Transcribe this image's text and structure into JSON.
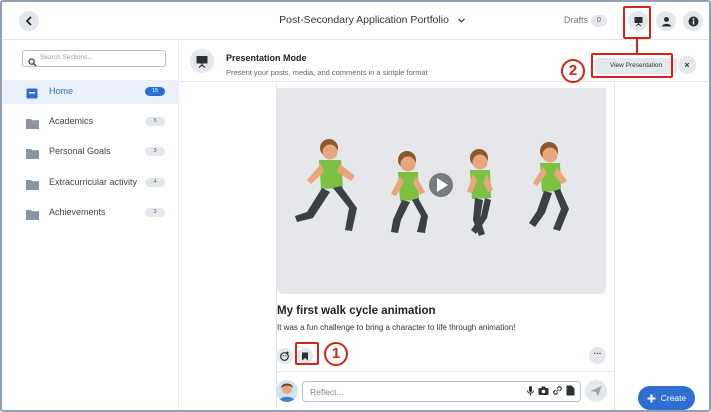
{
  "header": {
    "title": "Post-Secondary Application Portfolio",
    "drafts_label": "Drafts",
    "drafts_count": "0"
  },
  "sidebar": {
    "search_placeholder": "Search Sections...",
    "items": [
      {
        "label": "Home",
        "count": "15",
        "active": true
      },
      {
        "label": "Academics",
        "count": "5"
      },
      {
        "label": "Personal Goals",
        "count": "3"
      },
      {
        "label": "Extracurricular activity",
        "count": "4"
      },
      {
        "label": "Achievements",
        "count": "3"
      }
    ]
  },
  "banner": {
    "title": "Presentation Mode",
    "subtitle": "Present your posts, media, and comments in a simple format",
    "view_button": "View Presentation",
    "close_symbol": "×"
  },
  "post": {
    "title": "My first walk cycle animation",
    "text": "It was a fun challenge to bring a character to life through animation!",
    "more_symbol": "···"
  },
  "comment": {
    "placeholder": "Reflect..."
  },
  "create_button": "Create",
  "annotations": {
    "step1": "1",
    "step2": "2"
  },
  "colors": {
    "accent": "#2e6fd1",
    "highlight": "#d6221b",
    "shirt": "#7cc142",
    "pants": "#3b3f46"
  },
  "icons": [
    "back-icon",
    "chevron-down-icon",
    "presentation-icon",
    "person-icon",
    "info-icon",
    "search-icon",
    "folder-icon",
    "play-icon",
    "emoji-add-icon",
    "bookmark-icon",
    "microphone-icon",
    "camera-icon",
    "link-icon",
    "file-icon",
    "send-icon",
    "plus-icon"
  ]
}
